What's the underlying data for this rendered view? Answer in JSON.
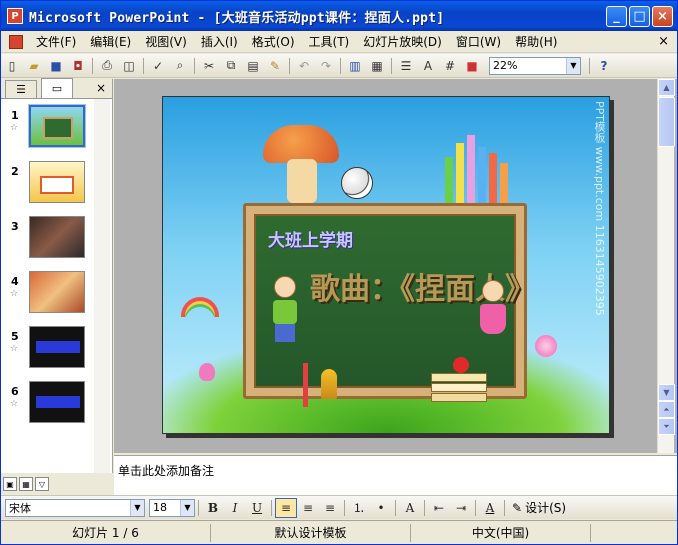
{
  "window": {
    "title": "Microsoft PowerPoint - [大班音乐活动ppt课件：捏面人.ppt]",
    "app_icon": "powerpoint-icon",
    "controls": {
      "minimize": "_",
      "maximize": "□",
      "close": "×"
    }
  },
  "menubar": {
    "items": [
      "文件(F)",
      "编辑(E)",
      "视图(V)",
      "插入(I)",
      "格式(O)",
      "工具(T)",
      "幻灯片放映(D)",
      "窗口(W)",
      "帮助(H)"
    ],
    "close_doc": "×"
  },
  "standard_toolbar": {
    "icons": [
      "new-icon",
      "open-icon",
      "save-icon",
      "permission-icon",
      "print-icon",
      "print-preview-icon",
      "spelling-icon",
      "research-icon",
      "cut-icon",
      "copy-icon",
      "paste-icon",
      "format-painter-icon",
      "undo-icon",
      "redo-icon",
      "insert-chart-icon",
      "insert-table-icon",
      "expand-all-icon",
      "show-formatting-icon",
      "show-grid-icon",
      "color-grayscale-icon"
    ],
    "zoom": "22%",
    "help": "?"
  },
  "left_pane": {
    "tabs": [
      "outline",
      "slides"
    ],
    "close": "×",
    "slides": [
      {
        "num": "1",
        "star": "☆"
      },
      {
        "num": "2",
        "star": ""
      },
      {
        "num": "3",
        "star": ""
      },
      {
        "num": "4",
        "star": "☆"
      },
      {
        "num": "5",
        "star": "☆"
      },
      {
        "num": "6",
        "star": "☆"
      }
    ]
  },
  "slide": {
    "subtitle": "大班上学期",
    "title": "歌曲：《捏面人》",
    "watermark": "PPT模板 www.ppt.com 1163145902395"
  },
  "notes": {
    "placeholder": "单击此处添加备注"
  },
  "formatting_toolbar": {
    "font": "宋体",
    "size": "18",
    "bold": "B",
    "italic": "I",
    "underline": "U",
    "design": "设计(S)"
  },
  "statusbar": {
    "slide_info": "幻灯片 1 / 6",
    "template": "默认设计模板",
    "language": "中文(中国)"
  },
  "colors": {
    "title_bar": "#0a48d4",
    "board": "#2f6b30",
    "selection": "#316ac5"
  }
}
